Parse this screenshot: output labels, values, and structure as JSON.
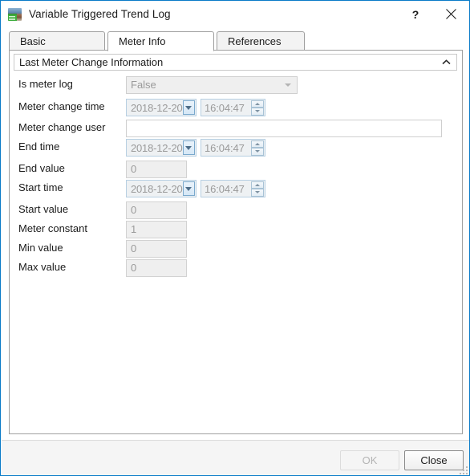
{
  "window": {
    "title": "Variable Triggered Trend Log",
    "icon": "trend-log-icon",
    "help_label": "?",
    "close_label": "✕",
    "border_color": "#0a7bc8"
  },
  "tabs": [
    {
      "id": "basic",
      "label": "Basic",
      "active": false
    },
    {
      "id": "meter-info",
      "label": "Meter Info",
      "active": true
    },
    {
      "id": "references",
      "label": "References",
      "active": false
    }
  ],
  "group": {
    "title": "Last Meter Change Information",
    "collapse_icon": "chevron-up-icon",
    "expanded": true
  },
  "form": {
    "is_meter_log": {
      "label": "Is meter log",
      "value": "False",
      "type": "combobox",
      "disabled": true
    },
    "meter_change_time": {
      "label": "Meter change time",
      "date": "2018-12-20",
      "time": "16:04:47",
      "type": "datetime",
      "disabled": true
    },
    "meter_change_user": {
      "label": "Meter change user",
      "value": "",
      "placeholder": "",
      "type": "textbox",
      "disabled": false
    },
    "end_time": {
      "label": "End time",
      "date": "2018-12-20",
      "time": "16:04:47",
      "type": "datetime",
      "disabled": true
    },
    "end_value": {
      "label": "End value",
      "value": "0",
      "type": "textbox",
      "disabled": true
    },
    "start_time": {
      "label": "Start time",
      "date": "2018-12-20",
      "time": "16:04:47",
      "type": "datetime",
      "disabled": true
    },
    "start_value": {
      "label": "Start value",
      "value": "0",
      "type": "textbox",
      "disabled": true
    },
    "meter_constant": {
      "label": "Meter constant",
      "value": "1",
      "type": "textbox",
      "disabled": true
    },
    "min_value": {
      "label": "Min value",
      "value": "0",
      "type": "textbox",
      "disabled": true
    },
    "max_value": {
      "label": "Max value",
      "value": "0",
      "type": "textbox",
      "disabled": true
    }
  },
  "footer": {
    "ok_label": "OK",
    "ok_disabled": true,
    "close_label": "Close",
    "close_disabled": false,
    "resize_grip": "resize-grip-icon"
  }
}
